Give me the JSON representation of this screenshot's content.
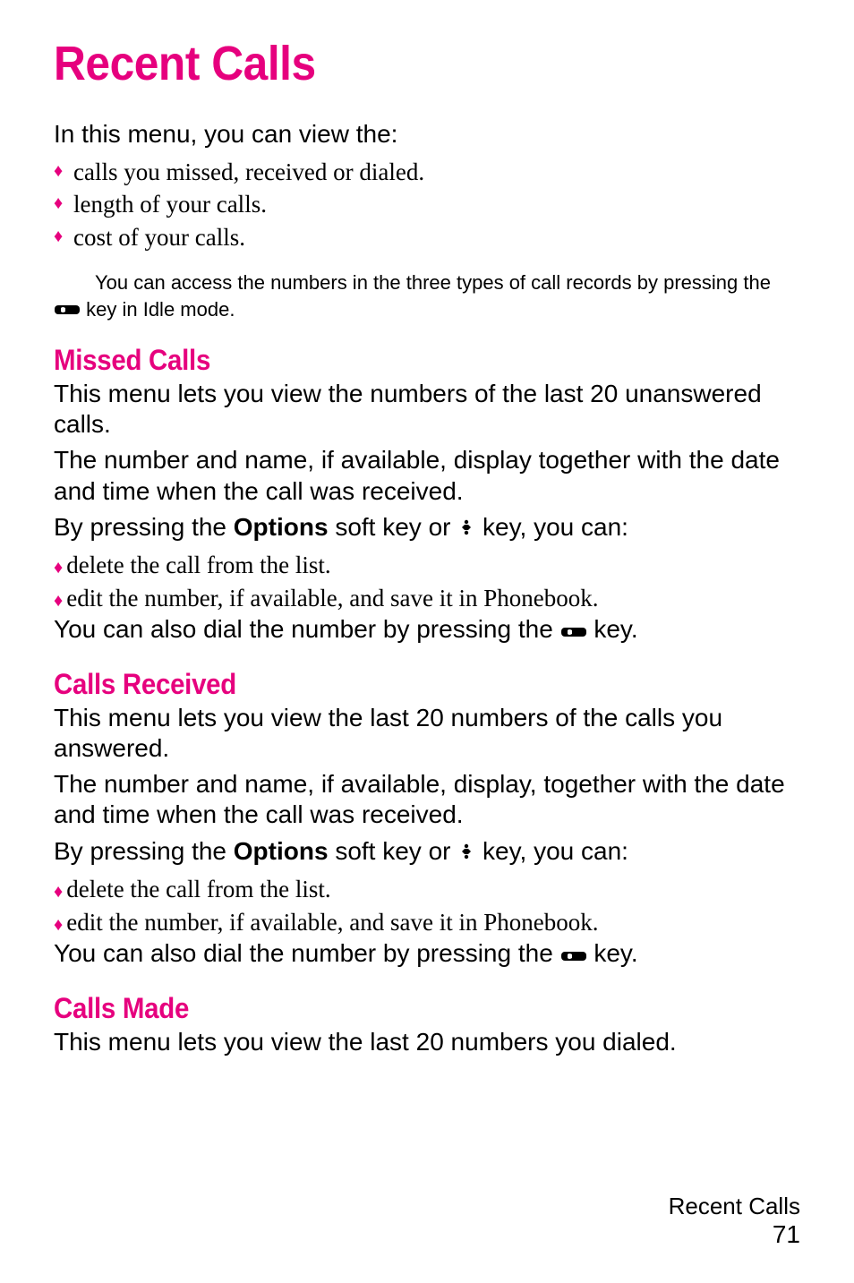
{
  "title": "Recent Calls",
  "intro": "In this menu, you can view the:",
  "intro_bullets": [
    "calls you missed, received or dialed.",
    "length of your calls.",
    "cost of your calls."
  ],
  "note": {
    "prefix": "You can access the numbers in the three types of call records by pressing the ",
    "suffix": " key in Idle mode."
  },
  "sections": {
    "missed": {
      "heading": "Missed Calls",
      "p1": "This menu lets you view the numbers of the last 20 unanswered calls.",
      "p2": "The number and name, if available, display together with the date and time when the call was received.",
      "p3_pre": "By pressing the ",
      "p3_bold": "Options",
      "p3_mid": " soft key or ",
      "p3_post": " key, you can:",
      "bullets": [
        "delete the call from the list.",
        "edit the number, if available, and save it in Phonebook."
      ],
      "p4_pre": "You can also dial the number by pressing the ",
      "p4_post": " key."
    },
    "received": {
      "heading": "Calls Received",
      "p1": "This menu lets you view the last 20 numbers of the calls you answered.",
      "p2": "The number and name, if available, display, together with the date and time when the call was received.",
      "p3_pre": "By pressing the ",
      "p3_bold": "Options",
      "p3_mid": " soft key or ",
      "p3_post": " key, you can:",
      "bullets": [
        "delete the call from the list.",
        "edit the number, if available, and save it in Phonebook."
      ],
      "p4_pre": "You can also dial the number by pressing the ",
      "p4_post": " key."
    },
    "made": {
      "heading": "Calls Made",
      "p1": "This menu lets you view the last 20 numbers you dialed."
    }
  },
  "footer": {
    "label": "Recent Calls",
    "page": "71"
  }
}
